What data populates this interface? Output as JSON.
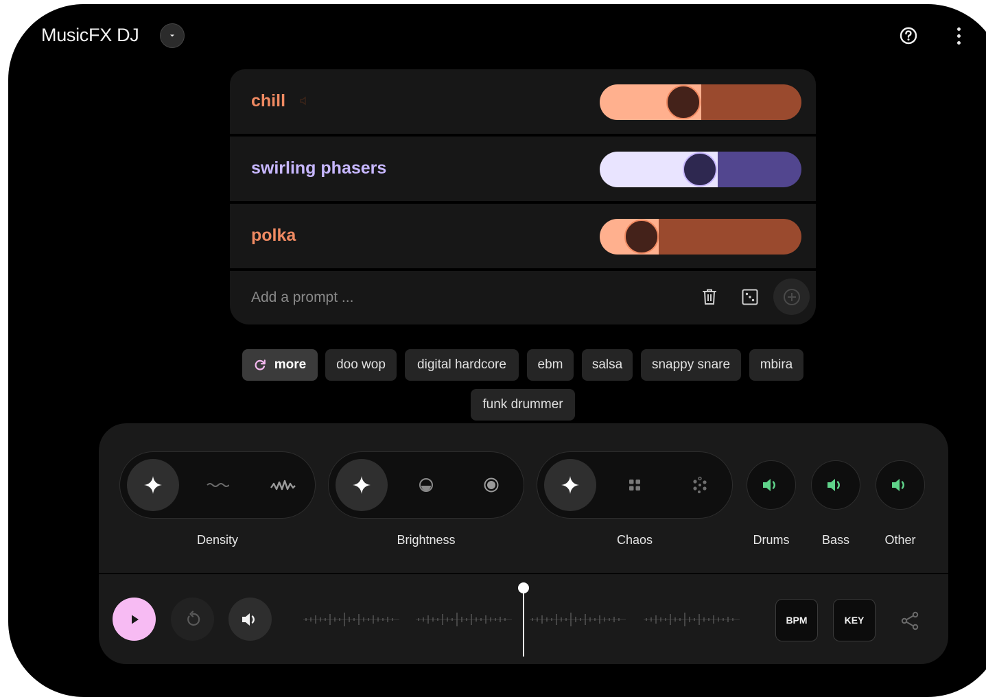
{
  "app": {
    "title": "MusicFX DJ"
  },
  "prompts": [
    {
      "label": "chill",
      "color": "#f08a62",
      "weight": 0.42,
      "muted_icon": "speaker-muted-icon"
    },
    {
      "label": "swirling phasers",
      "color": "#c7b7ff",
      "weight": 0.51
    },
    {
      "label": "polka",
      "color": "#f08a62",
      "weight": 0.21
    }
  ],
  "add_prompt": {
    "placeholder": "Add a prompt ..."
  },
  "chips": {
    "more_label": "more",
    "items": [
      "doo wop",
      "digital hardcore",
      "ebm",
      "salsa",
      "snappy snare",
      "mbira",
      "funk drummer"
    ]
  },
  "controls": {
    "density_label": "Density",
    "brightness_label": "Brightness",
    "chaos_label": "Chaos",
    "drums_label": "Drums",
    "bass_label": "Bass",
    "other_label": "Other"
  },
  "transport": {
    "bpm_label": "BPM",
    "key_label": "KEY"
  },
  "colors": {
    "orange": "#f08a62",
    "purple": "#c7b7ff",
    "play": "#f7bbf3",
    "stem_on": "#5fd38a"
  }
}
